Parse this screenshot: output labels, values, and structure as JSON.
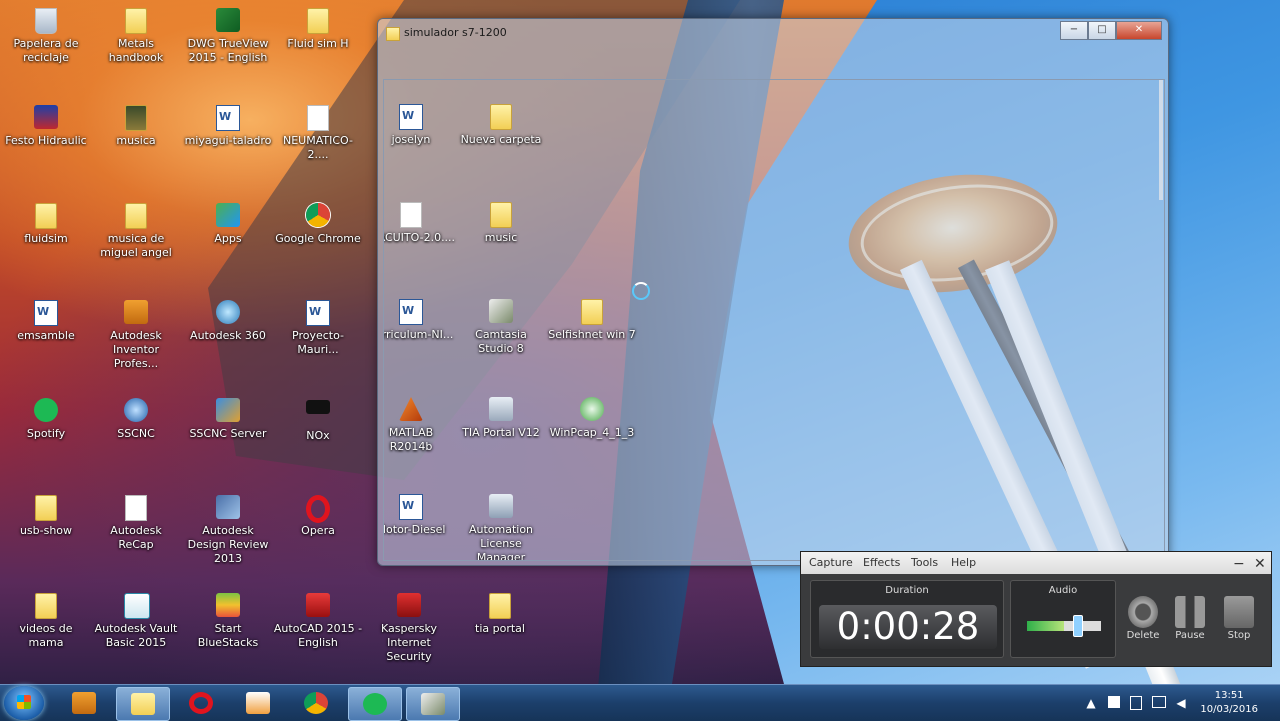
{
  "desktop": {
    "icons": [
      {
        "label": "Papelera de reciclaje",
        "icon": "recycle-bin-icon"
      },
      {
        "label": "Metals handbook",
        "icon": "folder-icon"
      },
      {
        "label": "DWG TrueView 2015 - English",
        "icon": "dwg-trueview-icon"
      },
      {
        "label": "Fluid sim H",
        "icon": "folder-icon"
      },
      {
        "label": "Festo Hidraulic",
        "icon": "festo-icon"
      },
      {
        "label": "musica",
        "icon": "music-folder-icon"
      },
      {
        "label": "miyagui-taladro",
        "icon": "word-doc-icon"
      },
      {
        "label": "NEUMATICO-2....",
        "icon": "document-icon"
      },
      {
        "label": "fluidsim",
        "icon": "folder-icon"
      },
      {
        "label": "musica de miguel angel",
        "icon": "folder-icon"
      },
      {
        "label": "Apps",
        "icon": "apps-icon"
      },
      {
        "label": "Google Chrome",
        "icon": "chrome-icon"
      },
      {
        "label": "emsamble",
        "icon": "word-doc-icon"
      },
      {
        "label": "Autodesk Inventor Profes...",
        "icon": "inventor-icon"
      },
      {
        "label": "Autodesk 360",
        "icon": "autodesk360-icon"
      },
      {
        "label": "Proyecto-Mauri...",
        "icon": "word-doc-icon"
      },
      {
        "label": "Spotify",
        "icon": "spotify-icon"
      },
      {
        "label": "SSCNC",
        "icon": "sscnc-icon"
      },
      {
        "label": "SSCNC Server",
        "icon": "sscnc-server-icon"
      },
      {
        "label": "NOx",
        "icon": "nox-icon"
      },
      {
        "label": "usb-show",
        "icon": "folder-icon"
      },
      {
        "label": "Autodesk ReCap",
        "icon": "document-icon"
      },
      {
        "label": "Autodesk Design Review 2013",
        "icon": "design-review-icon"
      },
      {
        "label": "Opera",
        "icon": "opera-icon"
      },
      {
        "label": "videos de mama",
        "icon": "folder-icon"
      },
      {
        "label": "Autodesk Vault Basic 2015",
        "icon": "vault-icon"
      },
      {
        "label": "Start BlueStacks",
        "icon": "bluestacks-icon"
      },
      {
        "label": "AutoCAD 2015 - English",
        "icon": "autocad-icon"
      },
      {
        "label": "Kaspersky Internet Security",
        "icon": "kaspersky-icon"
      },
      {
        "label": "tia portal",
        "icon": "folder-icon"
      }
    ]
  },
  "window": {
    "title": "simulador s7-1200",
    "minimize": "−",
    "maximize": "□",
    "close": "✕",
    "items": [
      {
        "label": "joselyn",
        "icon": "word-doc-icon"
      },
      {
        "label": "Nueva carpeta",
        "icon": "folder-icon"
      },
      {
        "label": "CIRCUITO-2.0....",
        "icon": "document-icon"
      },
      {
        "label": "music",
        "icon": "folder-icon"
      },
      {
        "label": "curriculum-NI...",
        "icon": "word-doc-icon"
      },
      {
        "label": "Camtasia Studio 8",
        "icon": "camtasia-icon"
      },
      {
        "label": "Selfishnet win 7",
        "icon": "folder-icon"
      },
      {
        "label": "MATLAB R2014b",
        "icon": "matlab-icon"
      },
      {
        "label": "TIA Portal V12",
        "icon": "tia-portal-icon"
      },
      {
        "label": "WinPcap_4_1_3",
        "icon": "winpcap-icon"
      },
      {
        "label": "Motor-Diesel",
        "icon": "word-doc-icon"
      },
      {
        "label": "Automation License Manager",
        "icon": "license-manager-icon"
      }
    ]
  },
  "recorder": {
    "menu": [
      "Capture",
      "Effects",
      "Tools",
      "Help"
    ],
    "minimize": "−",
    "close": "✕",
    "duration_label": "Duration",
    "duration": "0:00:28",
    "audio_label": "Audio",
    "audio_level": 0.7,
    "delete_label": "Delete",
    "pause_label": "Pause",
    "stop_label": "Stop"
  },
  "taskbar": {
    "apps": [
      "start-button",
      "inventor-icon",
      "explorer-icon",
      "opera-icon",
      "media-player-icon",
      "chrome-icon",
      "spotify-icon",
      "camtasia-icon"
    ],
    "time": "13:51",
    "date": "10/03/2016",
    "tray_arrow": "▲"
  }
}
